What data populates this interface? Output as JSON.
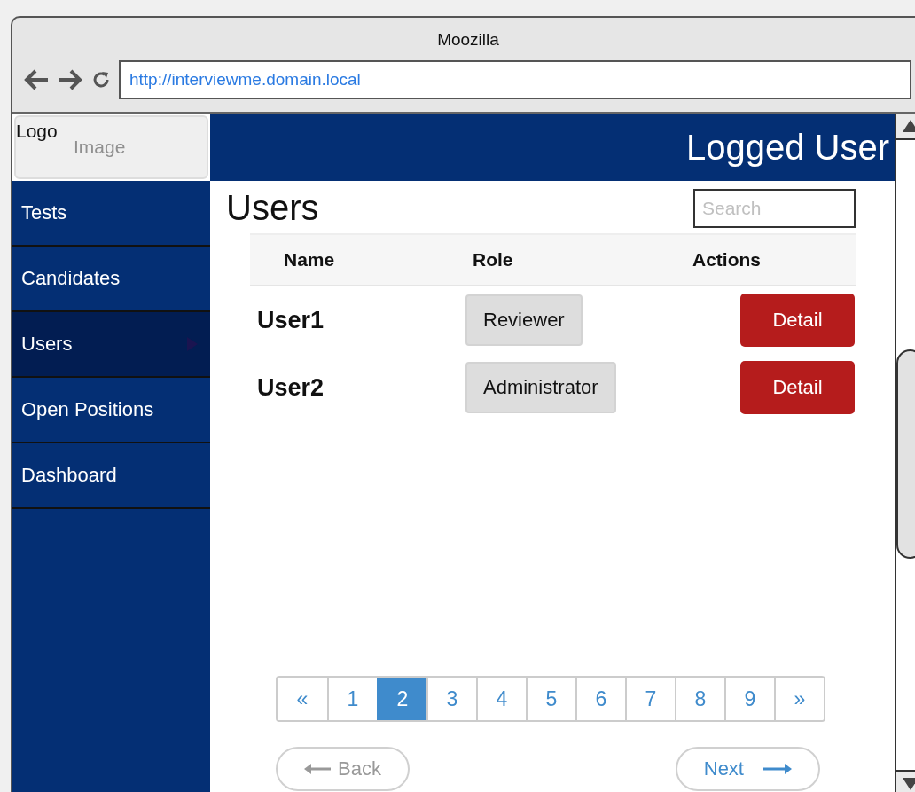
{
  "window": {
    "title": "Moozilla",
    "url": "http://interviewme.domain.local"
  },
  "logo": {
    "line_1": "Logo",
    "line_2": "Image"
  },
  "sidebar": {
    "items": [
      {
        "label": "Tests",
        "selected": false
      },
      {
        "label": "Candidates",
        "selected": false
      },
      {
        "label": "Users",
        "selected": true
      },
      {
        "label": "Open Positions",
        "selected": false
      },
      {
        "label": "Dashboard",
        "selected": false
      }
    ]
  },
  "header": {
    "user": "Logged User"
  },
  "page": {
    "title": "Users",
    "search": {
      "placeholder": "Search"
    }
  },
  "table": {
    "columns": [
      "Name",
      "Role",
      "Actions"
    ],
    "rows": [
      {
        "name": "User1",
        "role": "Reviewer",
        "action": "Detail"
      },
      {
        "name": "User2",
        "role": "Administrator",
        "action": "Detail"
      }
    ]
  },
  "pagination": {
    "pages": [
      {
        "label": "«",
        "selected": false
      },
      {
        "label": "1",
        "selected": false
      },
      {
        "label": "2",
        "selected": true
      },
      {
        "label": "3",
        "selected": false
      },
      {
        "label": "4",
        "selected": false
      },
      {
        "label": "5",
        "selected": false
      },
      {
        "label": "6",
        "selected": false
      },
      {
        "label": "7",
        "selected": false
      },
      {
        "label": "8",
        "selected": false
      },
      {
        "label": "9",
        "selected": false
      },
      {
        "label": "»",
        "selected": false
      }
    ]
  },
  "nav": {
    "back": {
      "label": "Back",
      "disabled": true
    },
    "next": {
      "label": "Next",
      "disabled": false
    }
  }
}
